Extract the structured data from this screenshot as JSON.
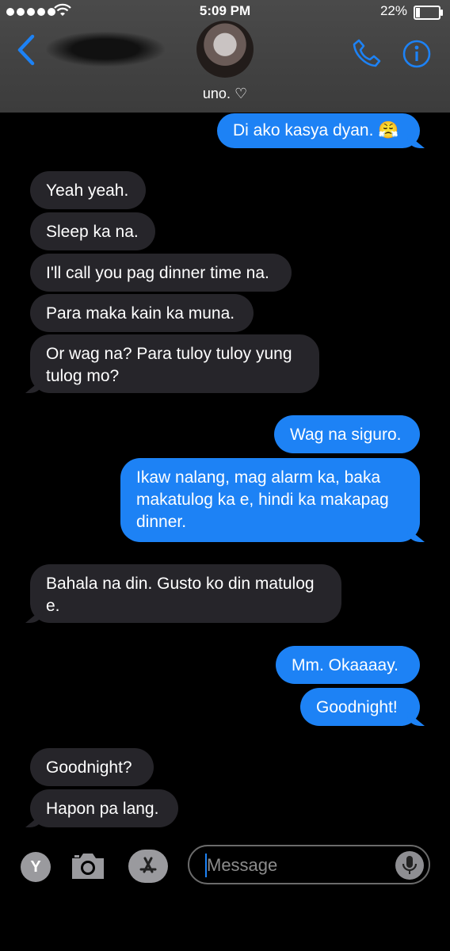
{
  "status_bar": {
    "time": "5:09 PM",
    "battery": "22%"
  },
  "header": {
    "contact_name": "uno. ♡"
  },
  "messages": [
    {
      "from": "me",
      "text": "Di ako kasya dyan. 😤"
    },
    {
      "from": "them",
      "text": "Yeah yeah."
    },
    {
      "from": "them",
      "text": "Sleep ka na."
    },
    {
      "from": "them",
      "text": "I'll call you pag dinner time na."
    },
    {
      "from": "them",
      "text": "Para maka kain ka muna."
    },
    {
      "from": "them",
      "text": "Or wag na? Para tuloy tuloy yung tulog mo?"
    },
    {
      "from": "me",
      "text": "Wag na siguro."
    },
    {
      "from": "me",
      "text": "Ikaw nalang, mag alarm ka, baka makatulog ka e, hindi ka makapag dinner."
    },
    {
      "from": "them",
      "text": "Bahala na din. Gusto ko din matulog e."
    },
    {
      "from": "me",
      "text": "Mm. Okaaaay."
    },
    {
      "from": "me",
      "text": "Goodnight!"
    },
    {
      "from": "them",
      "text": "Goodnight?"
    },
    {
      "from": "them",
      "text": "Hapon pa lang."
    }
  ],
  "compose": {
    "placeholder": "Message",
    "keyboard_letter": "Y"
  },
  "colors": {
    "outgoing": "#1d82f5",
    "incoming": "#26252a",
    "accent": "#1d82f5",
    "header": "#404040"
  },
  "icons": [
    "wifi-icon",
    "battery-icon",
    "back-chevron-icon",
    "phone-icon",
    "info-icon",
    "camera-icon",
    "app-store-icon",
    "microphone-icon"
  ]
}
